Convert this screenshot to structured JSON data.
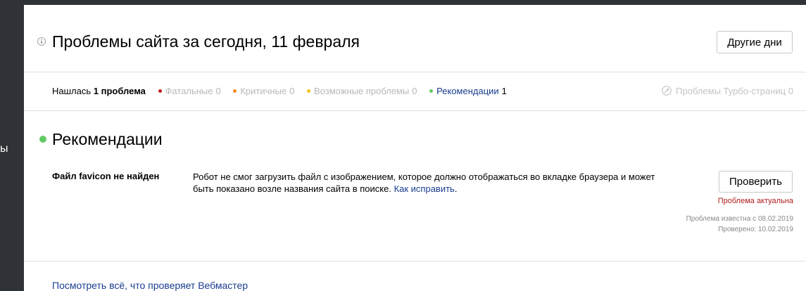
{
  "sidebar": {
    "partial_label": "ы"
  },
  "header": {
    "title": "Проблемы сайта за сегодня, 11 февраля",
    "other_days_label": "Другие дни"
  },
  "summary": {
    "found_prefix": "Нашлась",
    "found_count": "1 проблема",
    "severities": [
      {
        "label": "Фатальные",
        "count": "0",
        "color": "#c81c1c",
        "active": false
      },
      {
        "label": "Критичные",
        "count": "0",
        "color": "#f08c1e",
        "active": false
      },
      {
        "label": "Возможные проблемы",
        "count": "0",
        "color": "#f5c21b",
        "active": false
      },
      {
        "label": "Рекомендации",
        "count": "1",
        "color": "#61c961",
        "active": true
      }
    ],
    "turbo_label": "Проблемы Турбо-страниц",
    "turbo_count": "0"
  },
  "section": {
    "title": "Рекомендации",
    "dot_color": "#61c961"
  },
  "problem": {
    "name": "Файл favicon не найден",
    "description": "Робот не смог загрузить файл с изображением, которое должно отображаться во вкладке браузера и может быть показано возле названия сайта в поиске.",
    "fix_link": "Как исправить",
    "check_label": "Проверить",
    "status": "Проблема актуальна",
    "known_since": "Проблема известна с 08.02.2019",
    "checked": "Проверено: 10.02.2019"
  },
  "footer": {
    "link": "Посмотреть всё, что проверяет Вебмастер"
  }
}
